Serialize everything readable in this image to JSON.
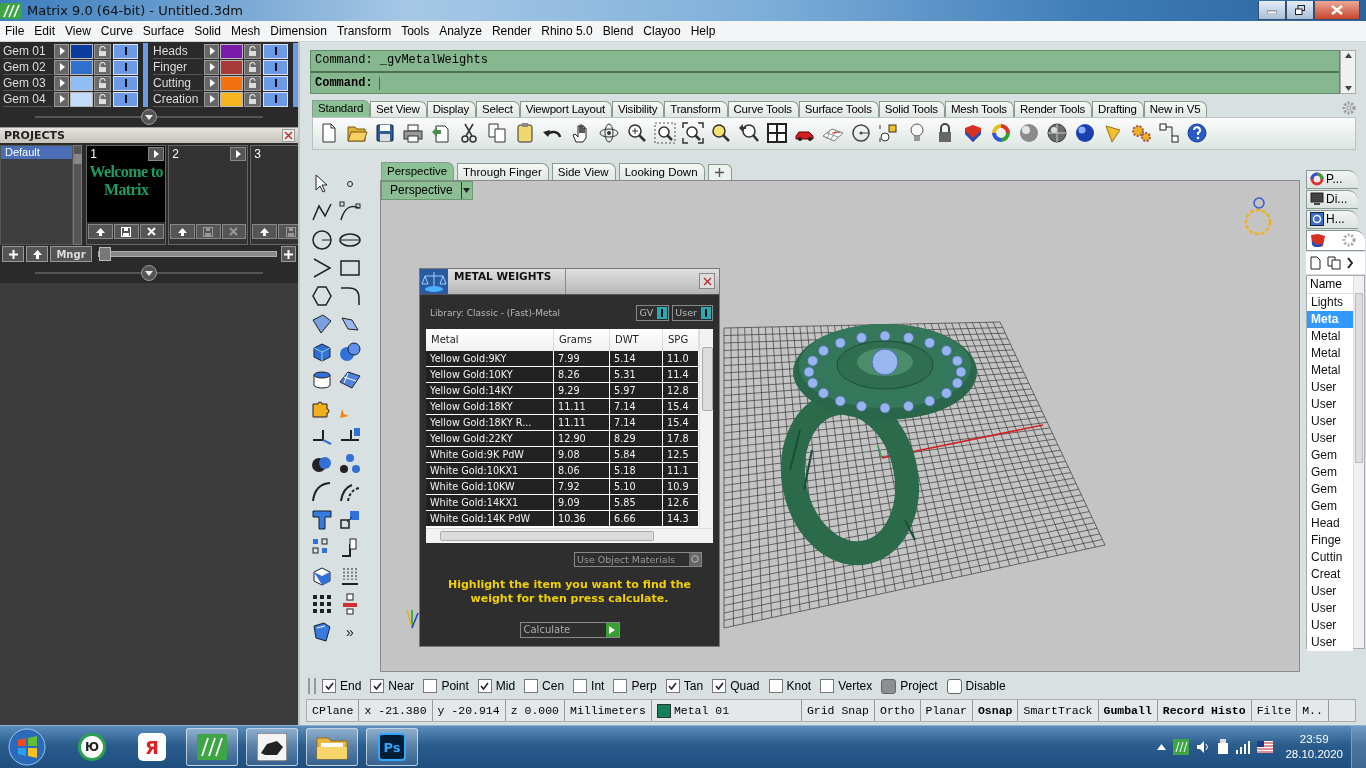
{
  "window": {
    "title": "Matrix 9.0 (64-bit) - Untitled.3dm"
  },
  "menu": [
    "File",
    "Edit",
    "View",
    "Curve",
    "Surface",
    "Solid",
    "Mesh",
    "Dimension",
    "Transform",
    "Tools",
    "Analyze",
    "Render",
    "Rhino 5.0",
    "Blend",
    "Clayoo",
    "Help"
  ],
  "layers": [
    {
      "name": "Gem 01",
      "color": "#0a3c9e",
      "visible": true
    },
    {
      "name": "Gem 02",
      "color": "#2f6fce",
      "visible": true
    },
    {
      "name": "Gem 03",
      "color": "#8fbdf5",
      "visible": true
    },
    {
      "name": "Gem 04",
      "color": "#c0dcfa",
      "visible": true
    },
    {
      "name": "Heads",
      "color": "#7a1cab",
      "visible": true
    },
    {
      "name": "Finger",
      "color": "#a83a3a",
      "visible": true
    },
    {
      "name": "Cutting",
      "color": "#f2700e",
      "visible": true
    },
    {
      "name": "Creation",
      "color": "#f7b51e",
      "visible": true
    }
  ],
  "projects": {
    "title": "PROJECTS",
    "list": [
      {
        "label": "Default",
        "selected": true
      }
    ],
    "slots": [
      {
        "number": "1",
        "empty": false,
        "preview": "Welcome to Matrix"
      },
      {
        "number": "2",
        "empty": true
      },
      {
        "number": "3",
        "empty": true
      }
    ],
    "manager_button": "Mngr",
    "zoom": {
      "level": 0
    }
  },
  "command": {
    "history": "Command: _gvMetalWeights",
    "prompt": "Command:"
  },
  "toolbar_tabs": [
    {
      "label": "Standard",
      "selected": true
    },
    {
      "label": "Set View",
      "selected": false
    },
    {
      "label": "Display",
      "selected": false
    },
    {
      "label": "Select",
      "selected": false
    },
    {
      "label": "Viewport Layout",
      "selected": false
    },
    {
      "label": "Visibility",
      "selected": false
    },
    {
      "label": "Transform",
      "selected": false
    },
    {
      "label": "Curve Tools",
      "selected": false
    },
    {
      "label": "Surface Tools",
      "selected": false
    },
    {
      "label": "Solid Tools",
      "selected": false
    },
    {
      "label": "Mesh Tools",
      "selected": false
    },
    {
      "label": "Render Tools",
      "selected": false
    },
    {
      "label": "Drafting",
      "selected": false
    },
    {
      "label": "New in V5",
      "selected": false
    }
  ],
  "left_toolbar": {
    "more": "»"
  },
  "viewport": {
    "tabs": [
      {
        "label": "Perspective",
        "selected": true
      },
      {
        "label": "Through Finger",
        "selected": false
      },
      {
        "label": "Side View",
        "selected": false
      },
      {
        "label": "Looking Down",
        "selected": false
      }
    ],
    "view_menu": "Perspective"
  },
  "metal_weights": {
    "title": "METAL WEIGHTS",
    "library": "Library: Classic - (Fast)-Metal",
    "toggles": [
      {
        "label": "GV",
        "on": true
      },
      {
        "label": "User",
        "on": true
      }
    ],
    "columns": [
      "Metal",
      "Grams",
      "DWT",
      "SPG"
    ],
    "rows": [
      [
        "Yellow Gold:9KY",
        "7.99",
        "5.14",
        "11.0"
      ],
      [
        "Yellow Gold:10KY",
        "8.26",
        "5.31",
        "11.4"
      ],
      [
        "Yellow Gold:14KY",
        "9.29",
        "5.97",
        "12.8"
      ],
      [
        "Yellow Gold:18KY",
        "11.11",
        "7.14",
        "15.4"
      ],
      [
        "Yellow Gold:18KY R...",
        "11.11",
        "7.14",
        "15.4"
      ],
      [
        "Yellow Gold:22KY",
        "12.90",
        "8.29",
        "17.8"
      ],
      [
        "White Gold:9K PdW",
        "9.08",
        "5.84",
        "12.5"
      ],
      [
        "White Gold:10KX1",
        "8.06",
        "5.18",
        "11.1"
      ],
      [
        "White Gold:10KW",
        "7.92",
        "5.10",
        "10.9"
      ],
      [
        "White Gold:14KX1",
        "9.09",
        "5.85",
        "12.6"
      ],
      [
        "White Gold:14K PdW",
        "10.36",
        "6.66",
        "14.3"
      ]
    ],
    "option": {
      "label": "Use Object Materials",
      "checked": false
    },
    "hint": "Highlight the item you want to find the weight for then press calculate.",
    "action": "Calculate"
  },
  "side_panel": {
    "tabs": [
      {
        "kind": "color-wheel",
        "label": "P...",
        "selected": false
      },
      {
        "kind": "display",
        "label": "Di...",
        "selected": false
      },
      {
        "kind": "help",
        "label": "H...",
        "selected": false
      },
      {
        "kind": "material",
        "selected": true
      }
    ],
    "column": "Name",
    "items": [
      {
        "label": "Lights",
        "selected": false
      },
      {
        "label": "Meta",
        "selected": true
      },
      {
        "label": "Metal",
        "selected": false
      },
      {
        "label": "Metal",
        "selected": false
      },
      {
        "label": "Metal",
        "selected": false
      },
      {
        "label": "User",
        "selected": false
      },
      {
        "label": "User",
        "selected": false
      },
      {
        "label": "User",
        "selected": false
      },
      {
        "label": "User",
        "selected": false
      },
      {
        "label": "Gem",
        "selected": false
      },
      {
        "label": "Gem",
        "selected": false
      },
      {
        "label": "Gem",
        "selected": false
      },
      {
        "label": "Gem",
        "selected": false
      },
      {
        "label": "Head",
        "selected": false
      },
      {
        "label": "Finge",
        "selected": false
      },
      {
        "label": "Cuttin",
        "selected": false
      },
      {
        "label": "Creat",
        "selected": false
      },
      {
        "label": "User",
        "selected": false
      },
      {
        "label": "User",
        "selected": false
      },
      {
        "label": "User",
        "selected": false
      },
      {
        "label": "User",
        "selected": false
      }
    ]
  },
  "osnaps": [
    {
      "kind": "check",
      "label": "End",
      "checked": true
    },
    {
      "kind": "check",
      "label": "Near",
      "checked": true
    },
    {
      "kind": "check",
      "label": "Point",
      "checked": false
    },
    {
      "kind": "check",
      "label": "Mid",
      "checked": true
    },
    {
      "kind": "check",
      "label": "Cen",
      "checked": false
    },
    {
      "kind": "check",
      "label": "Int",
      "checked": false
    },
    {
      "kind": "check",
      "label": "Perp",
      "checked": false
    },
    {
      "kind": "check",
      "label": "Tan",
      "checked": true
    },
    {
      "kind": "check",
      "label": "Quad",
      "checked": true
    },
    {
      "kind": "check",
      "label": "Knot",
      "checked": false
    },
    {
      "kind": "check",
      "label": "Vertex",
      "checked": false
    },
    {
      "kind": "toggle",
      "label": "Project",
      "checked": true
    },
    {
      "kind": "toggle",
      "label": "Disable",
      "checked": false
    }
  ],
  "status_bar": [
    {
      "kind": "readout",
      "label": "CPlane"
    },
    {
      "kind": "readout",
      "label": "x -21.380"
    },
    {
      "kind": "readout",
      "label": "y -20.914"
    },
    {
      "kind": "readout",
      "label": "z 0.000"
    },
    {
      "kind": "readout",
      "label": "Millimeters"
    },
    {
      "kind": "layer",
      "label": "Metal 01",
      "color": "#13805a"
    },
    {
      "kind": "pane",
      "label": "Grid Snap",
      "on": false
    },
    {
      "kind": "pane",
      "label": "Ortho",
      "on": false
    },
    {
      "kind": "pane",
      "label": "Planar",
      "on": false
    },
    {
      "kind": "pane",
      "label": "Osnap",
      "on": true
    },
    {
      "kind": "pane",
      "label": "SmartTrack",
      "on": false
    },
    {
      "kind": "pane",
      "label": "Gumball",
      "on": true
    },
    {
      "kind": "pane",
      "label": "Record Histo",
      "on": true
    },
    {
      "kind": "pane",
      "label": "Filte",
      "on": false
    },
    {
      "kind": "pane",
      "label": "M..",
      "on": false
    }
  ],
  "taskbar": {
    "apps": [
      {
        "kind": "yu",
        "label": "Ю",
        "running": false
      },
      {
        "kind": "yandex",
        "label": "Я",
        "running": false
      },
      {
        "kind": "matrix",
        "running": true
      },
      {
        "kind": "rhino",
        "running": true
      },
      {
        "kind": "folder",
        "running": true
      },
      {
        "kind": "ps",
        "label": "Ps",
        "running": true
      }
    ],
    "time": "23:59",
    "date": "28.10.2020"
  }
}
